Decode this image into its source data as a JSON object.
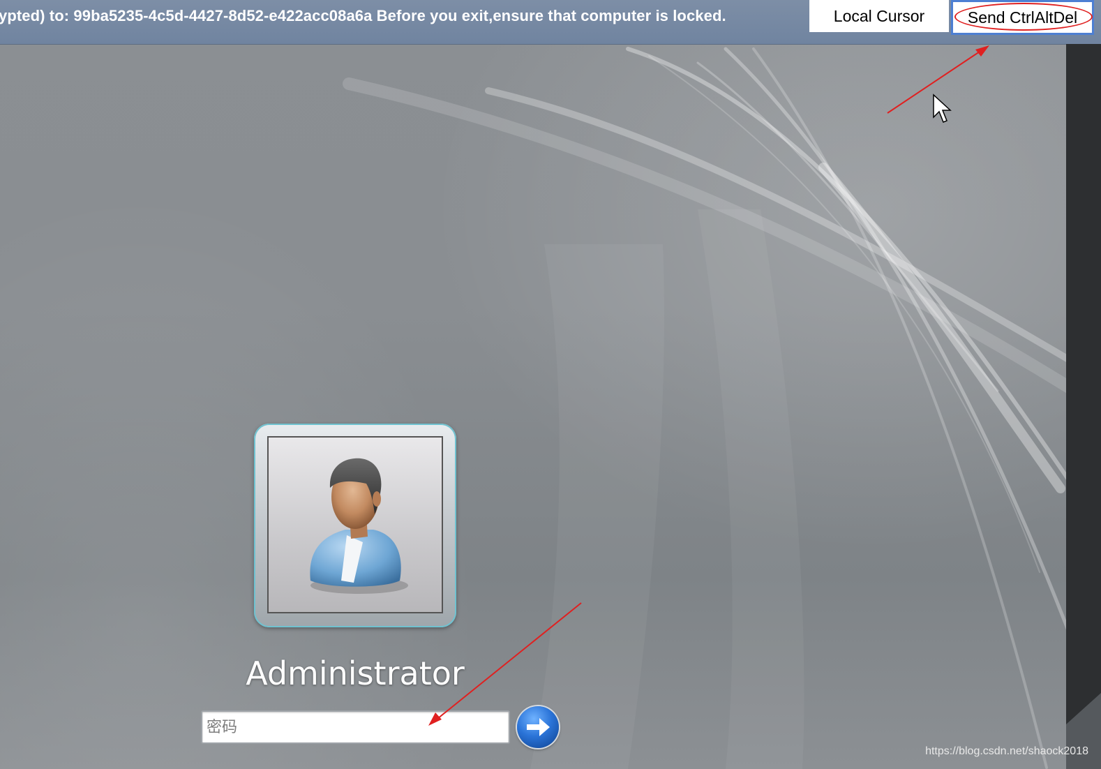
{
  "top_bar": {
    "banner_text": "ypted) to: 99ba5235-4c5d-4427-8d52-e422acc08a6a Before you exit,ensure that computer is locked.",
    "local_cursor_label": "Local Cursor",
    "send_cad_label": "Send CtrlAltDel"
  },
  "login": {
    "user_name": "Administrator",
    "password_placeholder": "密码",
    "password_value": ""
  },
  "watermark": "https://blog.csdn.net/shaock2018",
  "colors": {
    "annotation_red": "#e02020",
    "top_bar_blue": "#7084a0",
    "button_highlight_blue": "#4d7fd3"
  },
  "icons": {
    "user_avatar": "user-avatar-icon",
    "submit": "right-arrow-icon",
    "cursor": "mouse-pointer-icon"
  }
}
